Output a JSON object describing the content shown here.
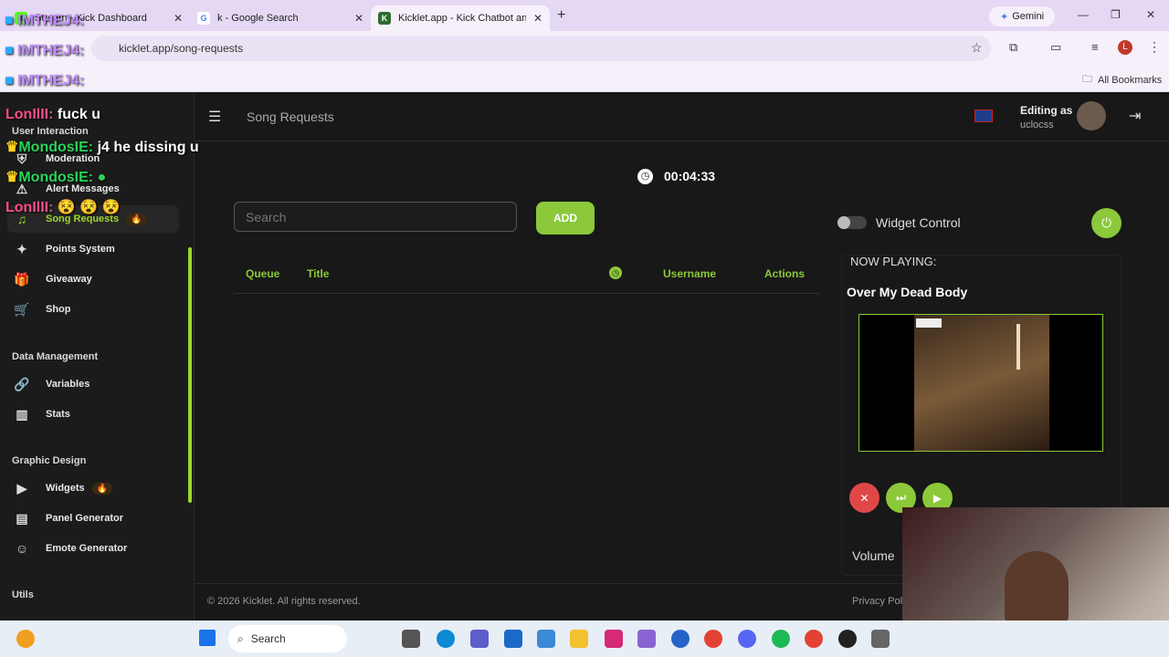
{
  "browser": {
    "tabs": [
      {
        "title": "Stream - Kick Dashboard",
        "fav": "K"
      },
      {
        "title": "k - Google Search",
        "fav": "G"
      },
      {
        "title": "Kickl​et.app - Kick Chatbot and",
        "fav": "K"
      }
    ],
    "gemini": "Gemini",
    "url": "kicklet.app/song-requests",
    "all_bookmarks": "All Bookmarks"
  },
  "overlay": {
    "names": [
      "IMTHEJ4:",
      "IMTHEJ4:",
      "IMTHEJ4:"
    ],
    "chat": [
      {
        "user": "LonIlII:",
        "msg": "fuck u",
        "color": "#ff4d8a"
      },
      {
        "user": "MondosIE:",
        "msg": "j4 he dissing u",
        "color": "#29d45a"
      },
      {
        "user": "MondosIE:",
        "msg": "",
        "color": "#29d45a"
      },
      {
        "user": "LonIlII:",
        "msg": "😵 😵 😵",
        "color": "#ff4d8a"
      }
    ]
  },
  "sidebar": {
    "sections": [
      "User Interaction",
      "Data Management",
      "Graphic Design",
      "Utils"
    ],
    "items": [
      {
        "label": "Moderation",
        "icon": "shield-icon"
      },
      {
        "label": "Alert Messages",
        "icon": "warning-icon"
      },
      {
        "label": "Song Requests",
        "icon": "music-icon",
        "badge": "🔥"
      },
      {
        "label": "Points System",
        "icon": "points-icon"
      },
      {
        "label": "Giveaway",
        "icon": "gift-icon"
      },
      {
        "label": "Shop",
        "icon": "cart-icon"
      },
      {
        "label": "Variables",
        "icon": "link-icon"
      },
      {
        "label": "Stats",
        "icon": "chart-icon"
      },
      {
        "label": "Widgets",
        "icon": "video-icon",
        "badge": "🔥"
      },
      {
        "label": "Panel Generator",
        "icon": "panel-icon"
      },
      {
        "label": "Emote Generator",
        "icon": "emote-icon"
      }
    ]
  },
  "header": {
    "title": "Song Requests",
    "editing_as": "Editing as",
    "user": "uclocss"
  },
  "timer": "00:04:33",
  "search": {
    "placeholder": "Search"
  },
  "add_label": "ADD",
  "table": {
    "queue": "Queue",
    "title": "Title",
    "username": "Username",
    "actions": "Actions"
  },
  "widget_control": "Widget Control",
  "now_playing": {
    "label": "NOW PLAYING:",
    "song": "Over My Dead Body",
    "volume": "Volume"
  },
  "footer": {
    "copyright": "© 2026 Kicklet. All rights reserved.",
    "privacy": "Privacy Pol"
  },
  "taskbar": {
    "search": "Search"
  },
  "colors": {
    "accent": "#8bc83a",
    "danger": "#e04848"
  }
}
